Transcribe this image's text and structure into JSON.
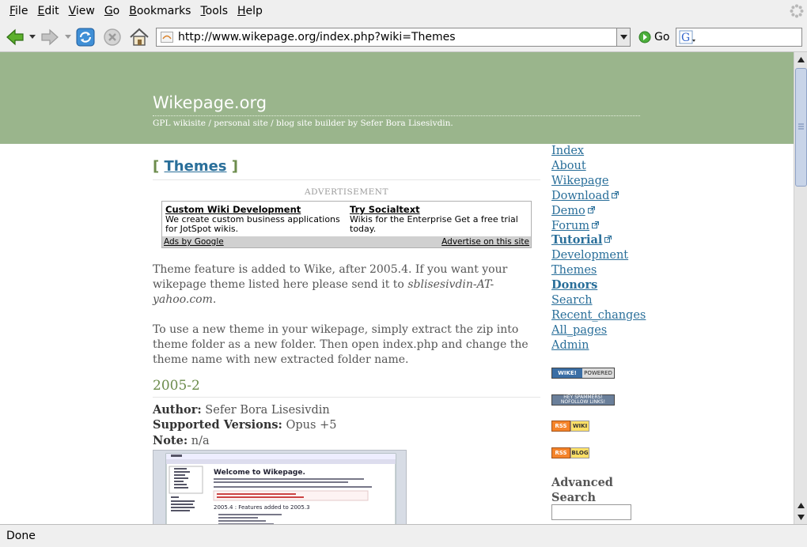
{
  "menu": {
    "items": [
      {
        "label_u": "F",
        "label_rest": "ile"
      },
      {
        "label_u": "E",
        "label_rest": "dit"
      },
      {
        "label_u": "V",
        "label_rest": "iew"
      },
      {
        "label_u": "G",
        "label_rest": "o"
      },
      {
        "label_u": "B",
        "label_rest": "ookmarks"
      },
      {
        "label_u": "T",
        "label_rest": "ools"
      },
      {
        "label_u": "H",
        "label_rest": "elp"
      }
    ]
  },
  "navbar": {
    "url": "http://www.wikepage.org/index.php?wiki=Themes",
    "go_label": "Go",
    "icons": [
      "back-icon",
      "forward-icon",
      "reload-icon",
      "stop-icon",
      "home-icon"
    ]
  },
  "site": {
    "title": "Wikepage.org",
    "tagline": "GPL wikisite / personal site / blog site builder by Sefer Bora Lisesivdin."
  },
  "page": {
    "bracket_open": "[",
    "heading": "Themes",
    "bracket_close": "]"
  },
  "ad": {
    "label": "ADVERTISEMENT",
    "units": [
      {
        "title": "Custom Wiki Development",
        "text": "We create custom business applications for JotSpot wikis."
      },
      {
        "title": "Try Socialtext",
        "text": "Wikis for the Enterprise Get a free trial today."
      }
    ],
    "footer_left": "Ads by Google",
    "footer_right": "Advertise on this site"
  },
  "content": {
    "para1_main": "Theme feature is added to Wike, after 2005.4. If you want your wikepage theme listed here please send it to ",
    "para1_email": "sblisesivdin-AT-yahoo.com",
    "para1_end": ".",
    "para2": "To use a new theme in your wikepage, simply extract the zip into theme folder as a new folder. Then open index.php and change the theme name with new extracted folder name.",
    "section_heading": "2005-2",
    "author_label": "Author:",
    "author_value": " Sefer Bora Lisesivdin",
    "versions_label": "Supported Versions:",
    "versions_value": " Opus +5",
    "note_label": "Note:",
    "note_value": " n/a"
  },
  "thumb": {
    "welcome": "Welcome to Wikepage.",
    "features": "2005.4 : Features added to 2005.3"
  },
  "sidebar": {
    "links": [
      {
        "label": "Index",
        "bold": false,
        "external": false
      },
      {
        "label": "About",
        "bold": false,
        "external": false
      },
      {
        "label": "Wikepage",
        "bold": false,
        "external": false
      },
      {
        "label": "Download",
        "bold": false,
        "external": true
      },
      {
        "label": "Demo",
        "bold": false,
        "external": true
      },
      {
        "label": "Forum",
        "bold": false,
        "external": true
      },
      {
        "label": "Tutorial",
        "bold": true,
        "external": true
      },
      {
        "label": "Development",
        "bold": false,
        "external": false
      },
      {
        "label": "Themes",
        "bold": false,
        "external": false
      },
      {
        "label": "Donors",
        "bold": true,
        "external": false
      },
      {
        "label": "Search",
        "bold": false,
        "external": false
      },
      {
        "label": "Recent_changes",
        "bold": false,
        "external": false
      },
      {
        "label": "All_pages",
        "bold": false,
        "external": false
      },
      {
        "label": "Admin",
        "bold": false,
        "external": false
      }
    ],
    "badges": {
      "wike_left": "WIKE!",
      "wike_right": "POWERED",
      "validator": "HEY SPAMMERS! NOFOLLOW LINKS!",
      "rss": "RSS",
      "rss_wiki": "WIKI",
      "rss_blog": "BLOG"
    },
    "adv_search": "Advanced Search"
  },
  "status": {
    "text": "Done"
  },
  "colors": {
    "header_bg": "#9ab58c",
    "link": "#2a6f9a",
    "heading_green": "#6c8c4c"
  }
}
